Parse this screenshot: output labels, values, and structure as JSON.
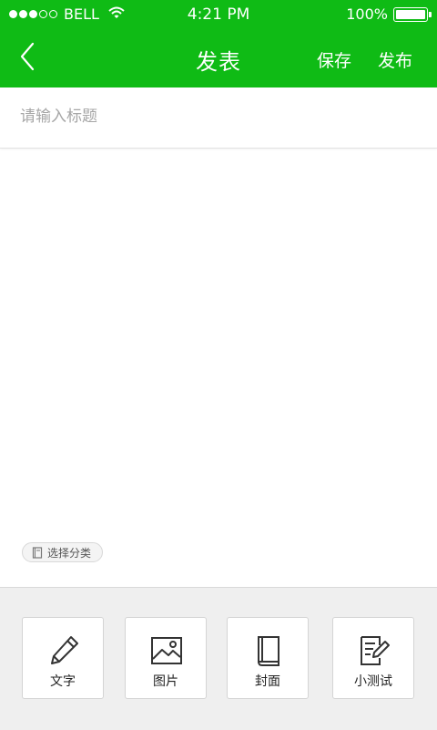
{
  "status_bar": {
    "carrier": "BELL",
    "time": "4:21 PM",
    "battery": "100%",
    "signal_bars": 3,
    "signal_total": 5
  },
  "nav": {
    "title": "发表",
    "save": "保存",
    "publish": "发布",
    "back_icon": "chevron-left-icon"
  },
  "editor": {
    "title_placeholder": "请输入标题",
    "title_value": ""
  },
  "category": {
    "label": "选择分类",
    "icon": "book-icon"
  },
  "toolbar": {
    "items": [
      {
        "label": "文字",
        "icon": "pencil-icon"
      },
      {
        "label": "图片",
        "icon": "image-icon"
      },
      {
        "label": "封面",
        "icon": "book-icon"
      },
      {
        "label": "小测试",
        "icon": "quiz-icon"
      }
    ]
  },
  "colors": {
    "brand": "#0fbb15",
    "toolbar_bg": "#efefef"
  }
}
